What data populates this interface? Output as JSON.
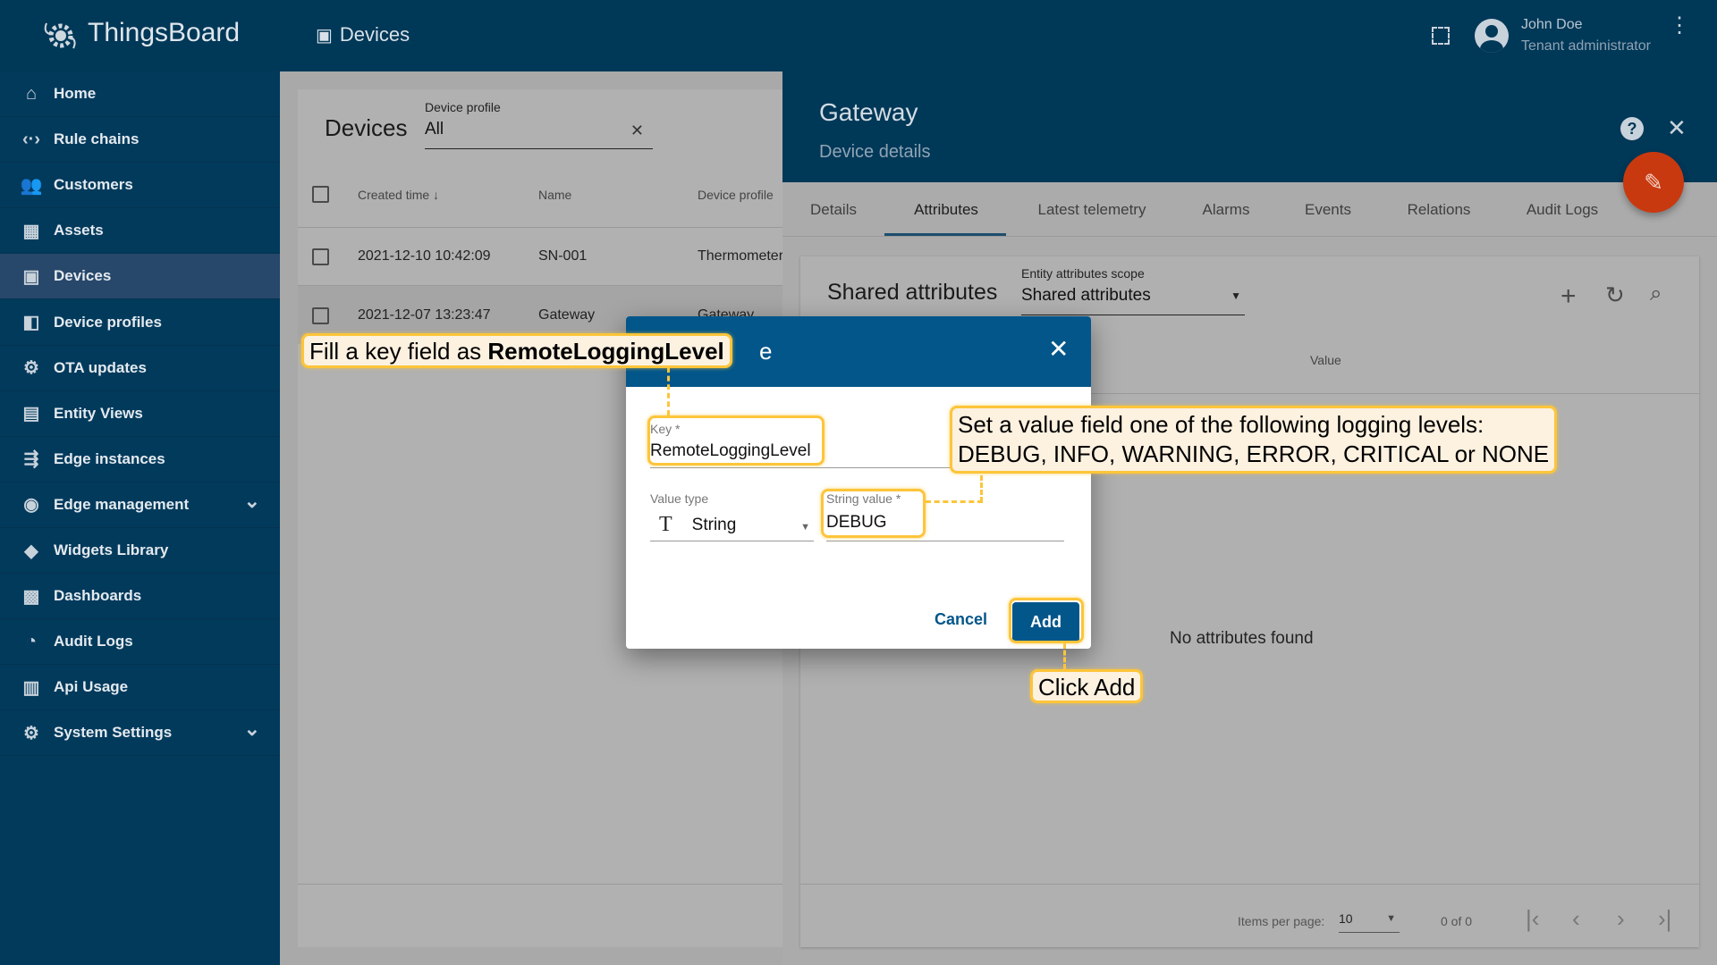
{
  "app": {
    "name": "ThingsBoard",
    "page_title": "Devices"
  },
  "user": {
    "name": "John Doe",
    "role": "Tenant administrator"
  },
  "sidebar": {
    "items": [
      {
        "label": "Home",
        "icon": "home-icon"
      },
      {
        "label": "Rule chains",
        "icon": "rule-chains-icon"
      },
      {
        "label": "Customers",
        "icon": "customers-icon"
      },
      {
        "label": "Assets",
        "icon": "assets-icon"
      },
      {
        "label": "Devices",
        "icon": "devices-icon",
        "active": true
      },
      {
        "label": "Device profiles",
        "icon": "device-profiles-icon"
      },
      {
        "label": "OTA updates",
        "icon": "ota-icon"
      },
      {
        "label": "Entity Views",
        "icon": "entity-views-icon"
      },
      {
        "label": "Edge instances",
        "icon": "edge-icon"
      },
      {
        "label": "Edge management",
        "icon": "edge-management-icon",
        "expandable": true
      },
      {
        "label": "Widgets Library",
        "icon": "widgets-icon"
      },
      {
        "label": "Dashboards",
        "icon": "dashboards-icon"
      },
      {
        "label": "Audit Logs",
        "icon": "audit-logs-icon"
      },
      {
        "label": "Api Usage",
        "icon": "api-usage-icon"
      },
      {
        "label": "System Settings",
        "icon": "settings-icon",
        "expandable": true
      }
    ]
  },
  "devices": {
    "title": "Devices",
    "filter_label": "Device profile",
    "filter_value": "All",
    "columns": [
      "Created time",
      "Name",
      "Device profile"
    ],
    "rows": [
      {
        "created": "2021-12-10 10:42:09",
        "name": "SN-001",
        "profile": "Thermometer"
      },
      {
        "created": "2021-12-07 13:23:47",
        "name": "Gateway",
        "profile": "Gateway"
      }
    ]
  },
  "details": {
    "title": "Gateway",
    "subtitle": "Device details",
    "tabs": [
      "Details",
      "Attributes",
      "Latest telemetry",
      "Alarms",
      "Events",
      "Relations",
      "Audit Logs"
    ],
    "active_tab": "Attributes",
    "section_title": "Shared attributes",
    "scope_label": "Entity attributes scope",
    "scope_value": "Shared attributes",
    "value_header": "Value",
    "empty_text": "No attributes found",
    "paginator": {
      "items_label": "Items per page:",
      "items_value": "10",
      "range": "0 of 0"
    }
  },
  "dialog": {
    "title_visible": "e",
    "key_label": "Key *",
    "key_value": "RemoteLoggingLevel",
    "type_label": "Value type",
    "type_value": "String",
    "string_label": "String value *",
    "string_value": "DEBUG",
    "cancel": "Cancel",
    "add": "Add"
  },
  "callouts": {
    "key_prefix": "Fill a key field as ",
    "key_bold": "RemoteLoggingLevel",
    "value_line1": "Set a value field one of the following logging levels:",
    "value_line2": "DEBUG, INFO, WARNING, ERROR, CRITICAL or NONE",
    "add": "Click Add"
  },
  "colors": {
    "primary": "#03568a",
    "fab": "#c9390f",
    "highlight": "#fcc53a"
  }
}
